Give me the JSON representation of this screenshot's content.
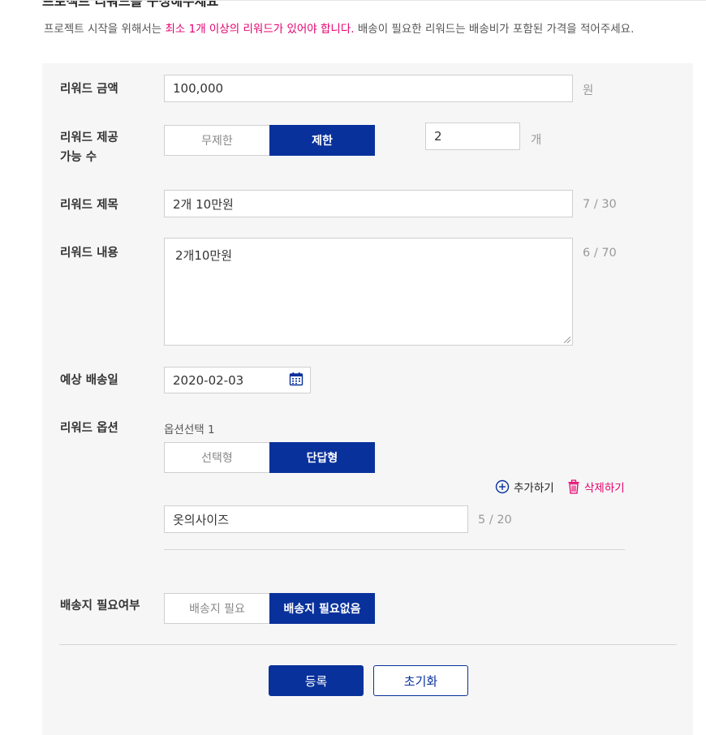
{
  "header": {
    "cut_title": "프로젝트 리워드를 구성해주세요",
    "notice_pre": "프로젝트 시작을 위해서는 ",
    "notice_highlight": "최소 1개 이상의 리워드가 있어야 합니다.",
    "notice_post": " 배송이 필요한 리워드는 배송비가 포함된 가격을 적어주세요."
  },
  "form": {
    "price": {
      "label": "리워드 금액",
      "value": "100,000",
      "unit": "원"
    },
    "quantity": {
      "label_line1": "리워드 제공",
      "label_line2": "가능 수",
      "options": [
        "무제한",
        "제한"
      ],
      "selected": "제한",
      "value": "2",
      "unit": "개"
    },
    "title": {
      "label": "리워드 제목",
      "value": "2개 10만원",
      "counter": "7 / 30"
    },
    "content": {
      "label": "리워드 내용",
      "value": "2개10만원",
      "counter": "6 / 70"
    },
    "ship_date": {
      "label": "예상 배송일",
      "value": "2020-02-03",
      "icon": "calendar-icon"
    },
    "option": {
      "label": "리워드 옵션",
      "sub_label": "옵션선택 1",
      "types": [
        "선택형",
        "단답형"
      ],
      "selected": "단답형",
      "add_label": "추가하기",
      "delete_label": "삭제하기",
      "value": "옷의사이즈",
      "counter": "5 / 20"
    },
    "shipping": {
      "label": "배송지 필요여부",
      "options": [
        "배송지 필요",
        "배송지 필요없음"
      ],
      "selected": "배송지 필요없음"
    }
  },
  "buttons": {
    "submit": "등록",
    "reset": "초기화"
  },
  "colors": {
    "primary": "#08319b",
    "highlight": "#e6006e",
    "panel": "#f6f6f6"
  }
}
